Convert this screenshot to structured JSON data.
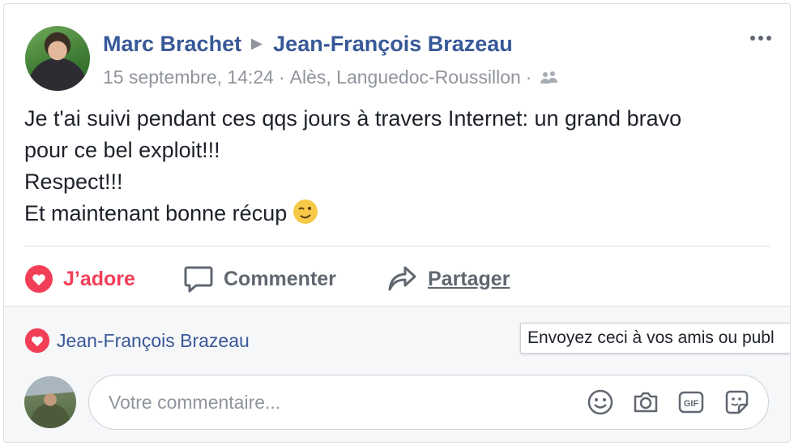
{
  "post": {
    "author": "Marc Brachet",
    "recipient": "Jean-François Brazeau",
    "date": "15 septembre, 14:24",
    "location": "Alès, Languedoc-Roussillon",
    "lines": [
      "Je t'ai suivi pendant ces qqs jours à travers Internet: un grand bravo",
      "pour ce bel exploit!!!",
      "Respect!!!",
      "Et maintenant bonne récup"
    ]
  },
  "actions": {
    "love": "J’adore",
    "comment": "Commenter",
    "share": "Partager"
  },
  "reactions": {
    "names": "Jean-François Brazeau"
  },
  "tooltip": {
    "text": "Envoyez ceci à vos amis ou publ"
  },
  "comment_box": {
    "placeholder": "Votre commentaire..."
  },
  "icons": {
    "audience": "friends-icon",
    "more": "more-options-icon",
    "love": "heart-icon",
    "comment": "speech-bubble-icon",
    "share": "share-arrow-icon",
    "emoji": "emoji-icon",
    "camera": "camera-icon",
    "gif": "gif-icon",
    "sticker": "sticker-icon"
  },
  "colors": {
    "link": "#385898",
    "love": "#f33e58",
    "muted": "#90949c"
  }
}
